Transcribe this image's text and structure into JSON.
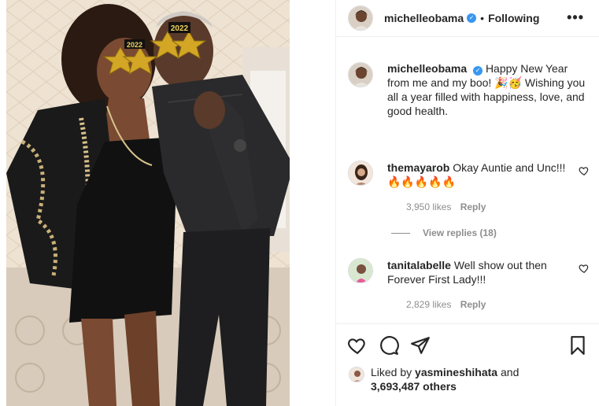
{
  "post": {
    "username": "michelleobama",
    "follow_status": "Following",
    "more_label": "•••",
    "verified_mark": "✓",
    "dot": "•"
  },
  "caption": {
    "username": "michelleobama",
    "text": "Happy New Year from me and my boo! 🎉🥳 Wishing you all a year filled with happiness, love, and good health."
  },
  "comments": [
    {
      "username": "themayarob",
      "text": "Okay Auntie and Unc!!!",
      "emoji": "🔥🔥🔥🔥🔥",
      "likes": "3,950 likes",
      "reply": "Reply",
      "view_replies": "View replies (18)"
    },
    {
      "username": "tanitalabelle",
      "text": "Well show out then Forever First Lady!!!",
      "likes": "2,829 likes",
      "reply": "Reply"
    }
  ],
  "likes": {
    "prefix": "Liked by",
    "user": "yasmineshihata",
    "and": "and",
    "others": "3,693,487 others"
  },
  "photo": {
    "glasses_text_left": "2022",
    "glasses_text_right": "2022"
  },
  "colors": {
    "accent_verified": "#3897f0",
    "text_primary": "#262626",
    "text_secondary": "#8e8e8e",
    "divider": "#efefef"
  },
  "icons": [
    "heart-icon",
    "comment-icon",
    "share-icon",
    "bookmark-icon",
    "more-icon",
    "verified-icon"
  ]
}
